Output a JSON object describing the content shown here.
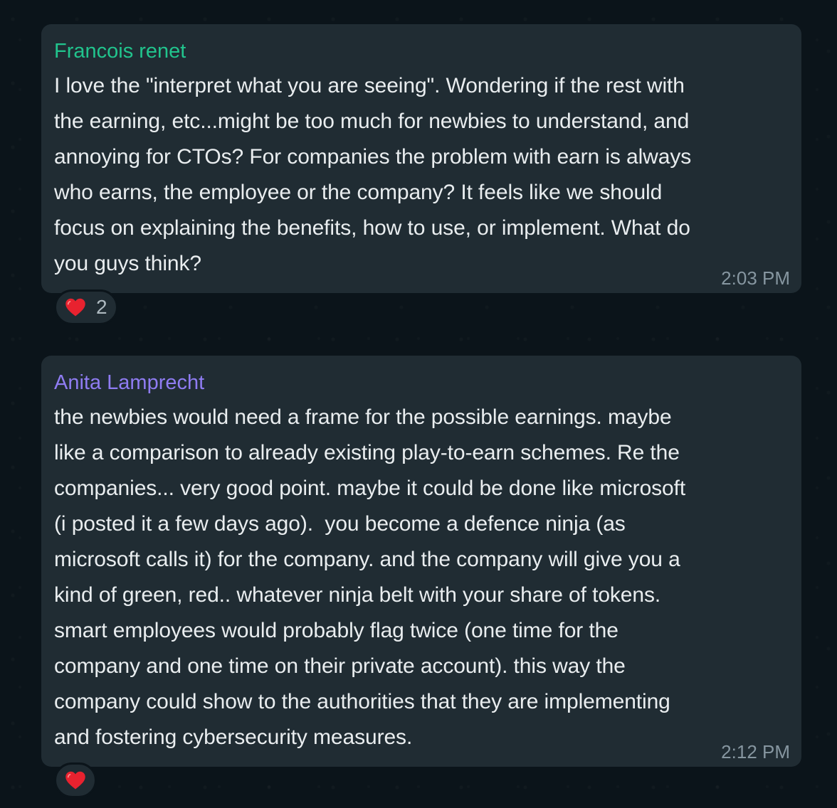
{
  "messages": [
    {
      "sender": "Francois renet",
      "sender_color": "#21c48d",
      "text": "I love the \"interpret what you are seeing\". Wondering if the rest with\nthe earning, etc...might be too much for newbies to understand, and\nannoying for CTOs? For companies the problem with earn is always\nwho earns, the employee or the company? It feels like we should\nfocus on explaining the benefits, how to use, or implement. What do\nyou guys think?",
      "time": "2:03 PM",
      "reaction": {
        "icon": "heart-icon",
        "count": "2"
      }
    },
    {
      "sender": "Anita Lamprecht",
      "sender_color": "#8f7cf2",
      "text": "the newbies would need a frame for the possible earnings. maybe\nlike a comparison to already existing play-to-earn schemes. Re the\ncompanies... very good point. maybe it could be done like microsoft\n(i posted it a few days ago).  you become a defence ninja (as\nmicrosoft calls it) for the company. and the company will give you a\nkind of green, red.. whatever ninja belt with your share of tokens.\nsmart employees would probably flag twice (one time for the\ncompany and one time on their private account). this way the\ncompany could show to the authorities that they are implementing\nand fostering cybersecurity measures.",
      "time": "2:12 PM",
      "reaction": {
        "icon": "heart-icon"
      }
    }
  ],
  "colors": {
    "background": "#0b141a",
    "bubble": "#202c33",
    "text": "#e9edef",
    "meta": "#8696a0",
    "heart": "#e8222f"
  }
}
